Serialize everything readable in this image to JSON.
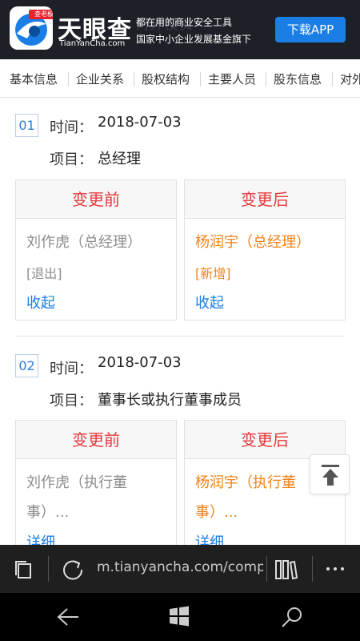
{
  "banner": {
    "logo_badge": "查老板",
    "brand_cn": "天眼查",
    "brand_en": "TianYanCha.com",
    "slogan_line1": "都在用的商业安全工具",
    "slogan_line2": "国家中小企业发展基金旗下",
    "download_label": "下载APP",
    "ghost_text": "对外投资"
  },
  "tabs": [
    "基本信息",
    "企业关系",
    "股权结构",
    "主要人员",
    "股东信息",
    "对外"
  ],
  "labels": {
    "time": "时间：",
    "item": "项目：",
    "before": "变更前",
    "after": "变更后"
  },
  "records": [
    {
      "num": "01",
      "time": "2018-07-03",
      "item": "总经理",
      "before": {
        "line1": "刘作虎（总经理）",
        "status": "[退出]",
        "action": "收起"
      },
      "after": {
        "line1": "杨润宇（总经理）",
        "status": "[新增]",
        "action": "收起"
      }
    },
    {
      "num": "02",
      "time": "2018-07-03",
      "item": "董事长或执行董事成员",
      "before": {
        "line1": "刘作虎（执行董",
        "line2": "事）...",
        "action": "详细"
      },
      "after": {
        "line1": "杨润宇（执行董",
        "line2": "事）...",
        "action": "详细"
      }
    }
  ],
  "browser": {
    "url": "m.tianyancha.com/company"
  },
  "icons": {
    "tabs": "tabs-icon",
    "refresh": "refresh-icon",
    "reading_view": "reading-view-icon",
    "more": "more-icon",
    "back": "back-arrow-icon",
    "home": "windows-logo-icon",
    "search": "search-icon",
    "back_to_top": "back-to-top-icon"
  },
  "colors": {
    "banner_bg": "#1d2026",
    "download_btn": "#1a7ee6",
    "header_red": "#e4393c",
    "new_orange": "#f08217",
    "link_blue": "#1a7ee6"
  }
}
